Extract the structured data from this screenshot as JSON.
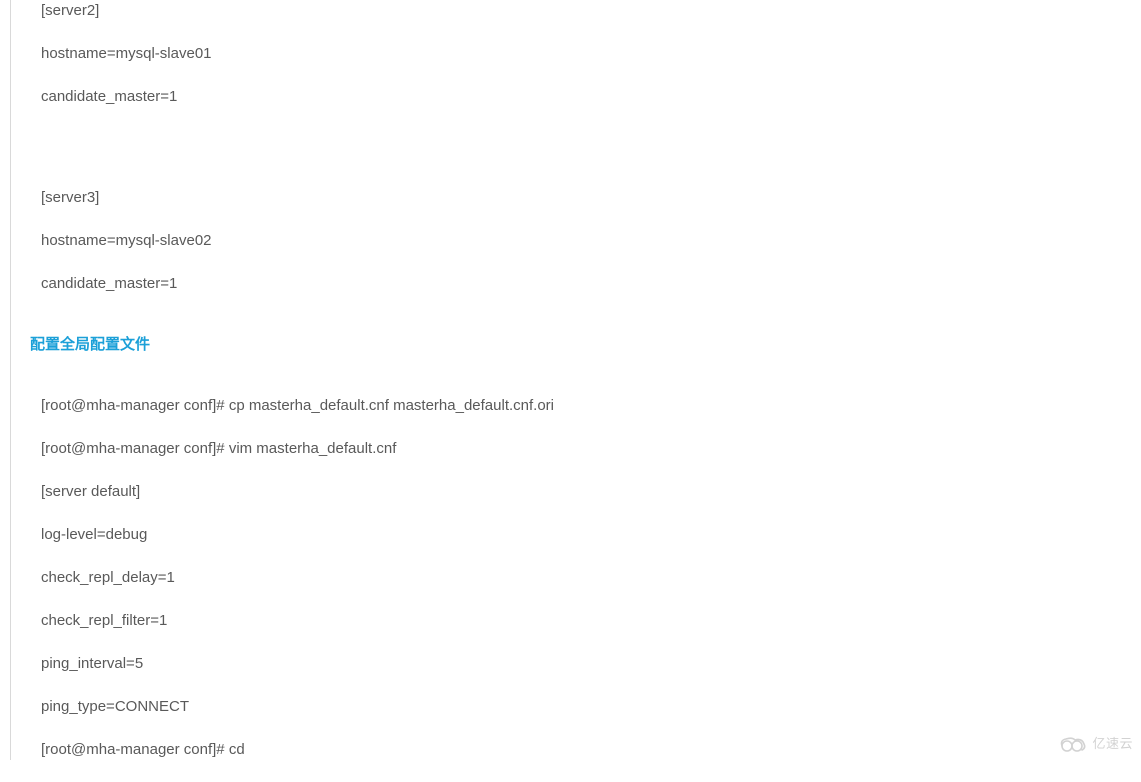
{
  "block1": {
    "lines": [
      "[server2]",
      "hostname=mysql-slave01",
      "candidate_master=1"
    ]
  },
  "block2": {
    "lines": [
      "[server3]",
      "hostname=mysql-slave02",
      "candidate_master=1"
    ]
  },
  "heading": "配置全局配置文件",
  "block3": {
    "lines": [
      "[root@mha-manager conf]# cp    masterha_default.cnf   masterha_default.cnf.ori",
      "[root@mha-manager conf]# vim   masterha_default.cnf",
      "[server default]",
      "log-level=debug",
      "check_repl_delay=1",
      "check_repl_filter=1",
      "ping_interval=5",
      "ping_type=CONNECT",
      "[root@mha-manager conf]# cd"
    ]
  },
  "watermark": "亿速云"
}
